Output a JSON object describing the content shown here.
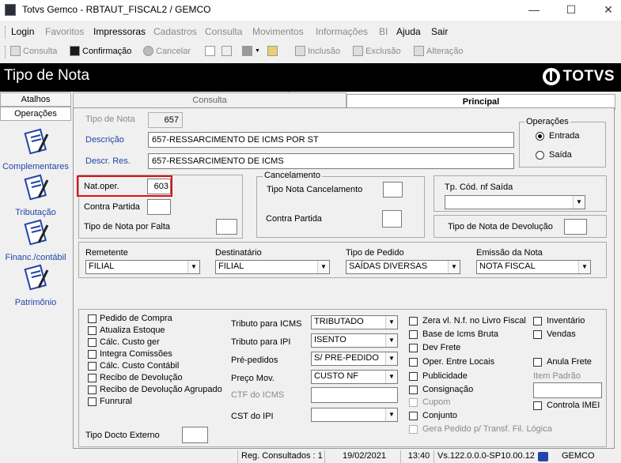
{
  "window": {
    "title": "Totvs Gemco - RBTAUT_FISCAL2 / GEMCO",
    "minimize": "—",
    "maximize": "☐",
    "close": "✕"
  },
  "menu": [
    {
      "label": "Login",
      "enabled": true
    },
    {
      "label": "Favoritos",
      "enabled": false
    },
    {
      "label": "Impressoras",
      "enabled": true
    },
    {
      "label": "Cadastros",
      "enabled": false
    },
    {
      "label": "Consulta",
      "enabled": false
    },
    {
      "label": "Movimentos",
      "enabled": false
    },
    {
      "label": "Informações",
      "enabled": false
    },
    {
      "label": "BI",
      "enabled": false
    },
    {
      "label": "Ajuda",
      "enabled": true
    },
    {
      "label": "Sair",
      "enabled": true
    }
  ],
  "toolbar": {
    "consulta": "Consulta",
    "confirmacao": "Confirmação",
    "cancelar": "Cancelar",
    "inclusao": "Inclusão",
    "exclusao": "Exclusão",
    "alteracao": "Alteração"
  },
  "header": {
    "title": "Tipo de Nota",
    "logo": "TOTVS"
  },
  "sidebar": {
    "tabs": [
      "Atalhos",
      "Operações"
    ],
    "items": [
      "Complementares",
      "Tributação",
      "Financ./contábil",
      "Patrimônio"
    ]
  },
  "tabs": {
    "consulta": "Consulta",
    "principal": "Principal"
  },
  "form": {
    "tipo_nota_label": "Tipo de Nota",
    "tipo_nota_value": "657",
    "descricao_label": "Descrição",
    "descricao_value": "657-RESSARCIMENTO DE ICMS POR ST",
    "descr_res_label": "Descr. Res.",
    "descr_res_value": "657-RESSARCIMENTO DE ICMS",
    "operacoes_title": "Operações",
    "entrada": "Entrada",
    "saida": "Saída",
    "nat_oper_label": "Nat.oper.",
    "nat_oper_value": "603",
    "contra_partida_label": "Contra Partida",
    "tipo_nota_falta_label": "Tipo de Nota por Falta",
    "cancelamento_title": "Cancelamento",
    "tipo_nota_cancel_label": "Tipo Nota Cancelamento",
    "contra_partida_cancel_label": "Contra Partida",
    "tp_cod_nf_saida_label": "Tp. Cód. nf Saída",
    "tipo_nota_devolucao_label": "Tipo de Nota de Devolução",
    "remetente_label": "Remetente",
    "remetente_value": "FILIAL",
    "destinatario_label": "Destinatário",
    "destinatario_value": "FILIAL",
    "tipo_pedido_label": "Tipo de Pedido",
    "tipo_pedido_value": "SAÍDAS DIVERSAS",
    "emissao_label": "Emissão da Nota",
    "emissao_value": "NOTA FISCAL"
  },
  "checks_left": [
    "Pedido de Compra",
    "Atualiza Estoque",
    "Cálc. Custo ger",
    "Integra Comissões",
    "Cálc. Custo Contábil",
    "Recibo de Devolução",
    "Recibo de Devolução Agrupado",
    "Funrural"
  ],
  "tributo": {
    "icms_label": "Tributo para ICMS",
    "icms_value": "TRIBUTADO",
    "ipi_label": "Tributo para IPI",
    "ipi_value": "ISENTO",
    "prepedidos_label": "Pré-pedidos",
    "prepedidos_value": "S/ PRE-PEDIDO",
    "preco_label": "Preço Mov.",
    "preco_value": "CUSTO NF",
    "ctf_label": "CTF do ICMS",
    "cst_label": "CST do IPI"
  },
  "checks_mid": [
    "Zera vl. N.f. no Livro Fiscal",
    "Base de Icms Bruta",
    "Dev Frete",
    "Oper. Entre Locais",
    "Publicidade",
    "Consignação",
    "Cupom",
    "Conjunto",
    "Gera Pedido p/ Transf. Fil. Lógica"
  ],
  "checks_right": {
    "inventario": "Inventário",
    "vendas": "Vendas",
    "anula_frete": "Anula Frete",
    "item_padrao": "Item Padrão",
    "controla_imei": "Controla IMEI"
  },
  "tipo_docto_externo": "Tipo Docto Externo",
  "statusbar": {
    "reg": "Reg. Consultados : 1",
    "date": "19/02/2021",
    "time": "13:40",
    "version": "Vs.122.0.0.0-SP10.00.12",
    "company": "GEMCO"
  }
}
